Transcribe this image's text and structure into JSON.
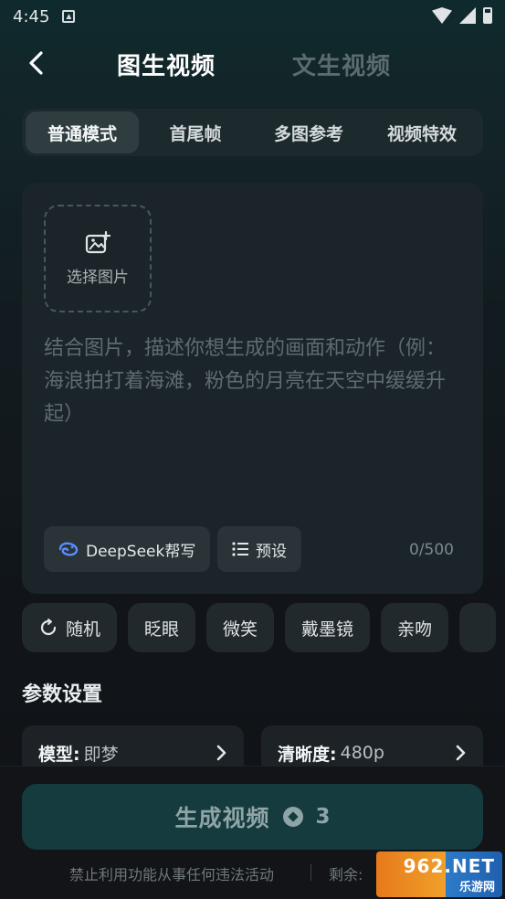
{
  "status": {
    "time": "4:45"
  },
  "header": {
    "back_icon": "chevron-left-icon",
    "tab_active": "图生视频",
    "tab_inactive": "文生视频"
  },
  "modes": [
    "普通模式",
    "首尾帧",
    "多图参考",
    "视频特效"
  ],
  "editor": {
    "upload_label": "选择图片",
    "upload_icon": "image-add-icon",
    "placeholder": "结合图片，描述你想生成的画面和动作（例：海浪拍打着海滩，粉色的月亮在天空中缓缓升起）",
    "deepseek_label": "DeepSeek帮写",
    "preset_label": "预设",
    "counter": "0/500"
  },
  "tags": [
    "随机",
    "眨眼",
    "微笑",
    "戴墨镜",
    "亲吻"
  ],
  "params": {
    "title": "参数设置",
    "model_key": "模型:",
    "model_value": "即梦",
    "clarity_key": "清晰度:",
    "clarity_value": "480p"
  },
  "generate": {
    "label": "生成视频",
    "cost": "3"
  },
  "footer": {
    "note": "禁止利用功能从事任何违法活动",
    "remain": "剩余:"
  },
  "watermark": {
    "top": "962.NET",
    "bottom": "乐游网"
  },
  "colors": {
    "accent": "#153b3f",
    "background": "#111418"
  }
}
